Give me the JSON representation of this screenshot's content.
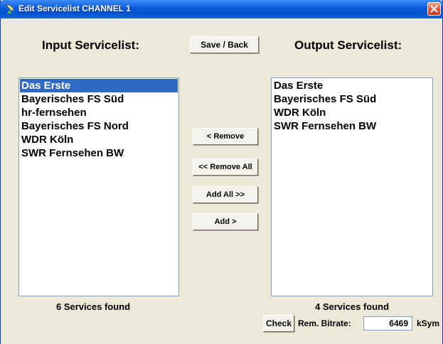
{
  "window": {
    "title": "Edit Servicelist CHANNEL 1"
  },
  "input": {
    "heading": "Input Servicelist:",
    "items": [
      "Das Erste",
      "Bayerisches FS Süd",
      "hr-fernsehen",
      "Bayerisches FS Nord",
      "WDR Köln",
      "SWR Fernsehen BW"
    ],
    "selected_item": "Das Erste",
    "status": "6 Services found"
  },
  "output": {
    "heading": "Output Servicelist:",
    "items": [
      "Das Erste",
      "Bayerisches FS Süd",
      "WDR Köln",
      "SWR Fernsehen BW"
    ],
    "status": "4 Services found"
  },
  "buttons": {
    "save_back": "Save / Back",
    "remove": "< Remove",
    "remove_all": "<< Remove All",
    "add_all": "Add All >>",
    "add": "Add >",
    "check": "Check"
  },
  "bitrate": {
    "label": "Rem. Bitrate:",
    "value": "6469",
    "unit": "kSym"
  },
  "colors": {
    "selection": "#316ac5",
    "title_bar": "#0a5ad8",
    "dialog_background": "#ece9d8"
  },
  "icons": {
    "app": "satellite-dish-icon",
    "close": "close-icon"
  }
}
